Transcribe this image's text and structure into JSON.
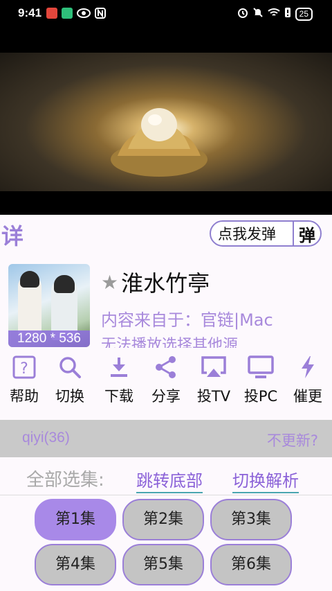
{
  "status_bar": {
    "time": "9:41",
    "battery": "25"
  },
  "header": {
    "detail_label": "详",
    "danmaku_send": "点我发弹",
    "danmaku_toggle": "弹"
  },
  "video": {
    "poster_resolution": "1280 * 536"
  },
  "info": {
    "title": "淮水竹亭",
    "source": "内容来自于：官链|Mac",
    "error": "无法播放选择其他源"
  },
  "actions": [
    {
      "label": "帮助",
      "icon": "help-icon"
    },
    {
      "label": "切换",
      "icon": "search-icon"
    },
    {
      "label": "下载",
      "icon": "download-icon"
    },
    {
      "label": "分享",
      "icon": "share-icon"
    },
    {
      "label": "投TV",
      "icon": "airplay-icon"
    },
    {
      "label": "投PC",
      "icon": "monitor-icon"
    },
    {
      "label": "催更",
      "icon": "flash-icon"
    }
  ],
  "source_bar": {
    "name": "qiyi(36)",
    "update": "不更新?"
  },
  "episodes_header": {
    "all": "全部选集:",
    "jump_bottom": "跳转底部",
    "switch_parse": "切换解析"
  },
  "episodes": [
    "第1集",
    "第2集",
    "第3集",
    "第4集",
    "第5集",
    "第6集"
  ],
  "colors": {
    "accent": "#a889e8",
    "text_accent": "#a889dc",
    "source_bar_bg": "#c9c9c9"
  }
}
